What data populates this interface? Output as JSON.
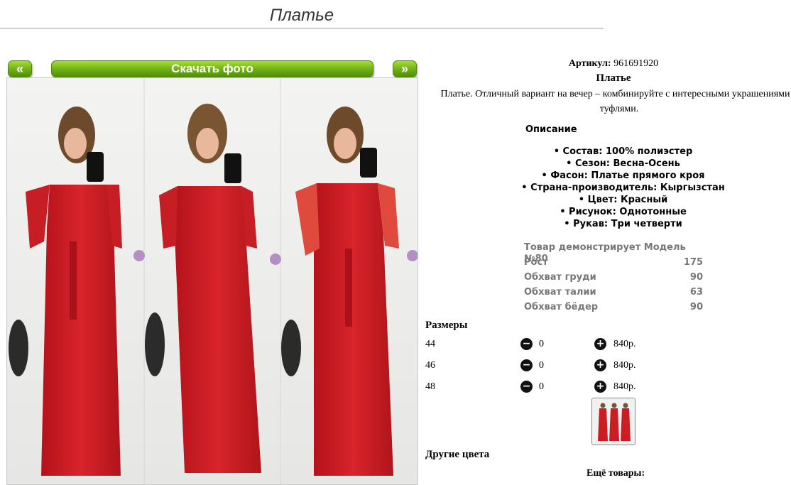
{
  "page": {
    "title": "Платье"
  },
  "buttons": {
    "prev": "«",
    "download": "Скачать фото",
    "next": "»"
  },
  "product": {
    "article_label": "Артикул:",
    "article_value": "961691920",
    "name": "Платье",
    "description": "Платье. Отличный вариант на вечер – комбинируйте с интересными украшениями и туфлями."
  },
  "details": {
    "heading": "Описание",
    "attributes": [
      "Состав: 100% полиэстер",
      "Сезон: Весна-Осень",
      "Фасон: Платье прямого кроя",
      "Страна-производитель: Кыргызстан",
      "Цвет: Красный",
      "Рисунок: Однотонные",
      "Рукав: Три четверти"
    ]
  },
  "model": {
    "heading": "Товар демонстрирует Модель №80",
    "rows": [
      {
        "label": "Рост",
        "value": "175"
      },
      {
        "label": "Обхват груди",
        "value": "90"
      },
      {
        "label": "Обхват талии",
        "value": "63"
      },
      {
        "label": "Обхват бёдер",
        "value": "90"
      }
    ]
  },
  "sizes": {
    "heading": "Размеры",
    "rows": [
      {
        "size": "44",
        "qty": "0",
        "price": "840р."
      },
      {
        "size": "46",
        "qty": "0",
        "price": "840р."
      },
      {
        "size": "48",
        "qty": "0",
        "price": "840р."
      }
    ],
    "minus_icon": "minus-circle-icon",
    "plus_icon": "plus-circle-icon"
  },
  "other_colors": {
    "heading": "Другие цвета"
  },
  "more": {
    "heading": "Ещё товары:"
  },
  "colors": {
    "button_green": "#6fae14",
    "dress_red": "#cc1d24",
    "text_muted": "#777777"
  }
}
